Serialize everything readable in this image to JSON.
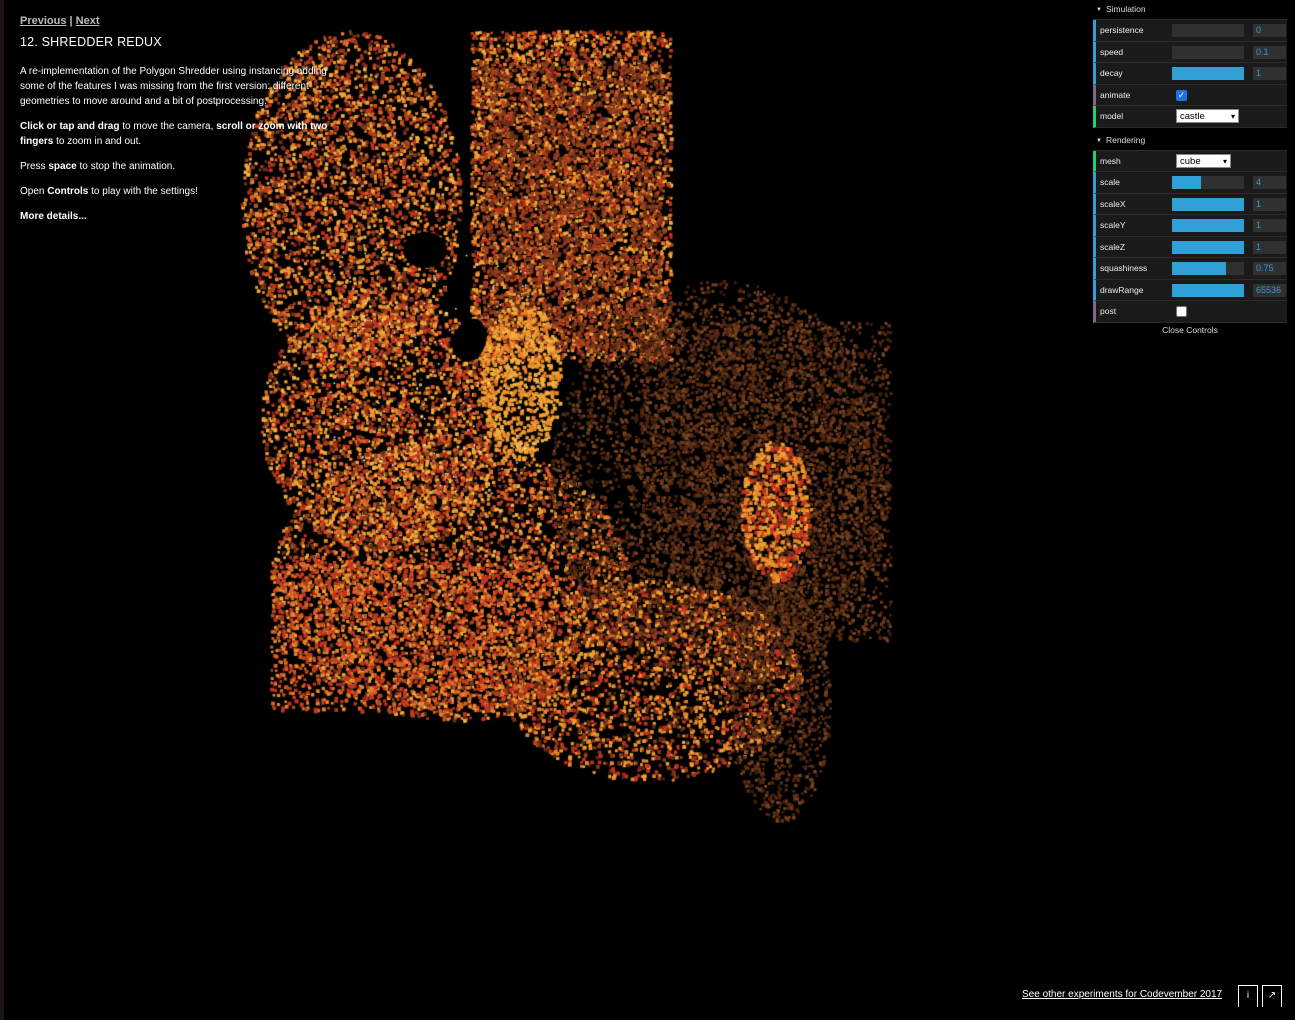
{
  "nav": {
    "previous": "Previous",
    "separator": "|",
    "next": "Next"
  },
  "title": "12. SHREDDER REDUX",
  "description": "A re-implementation of the Polygon Shredder using instancing adding some of the features I was missing from the first version: different geometries to move around and a bit of postprocessing.",
  "controls_help": {
    "click_drag": "Click or tap and drag",
    "move_camera": " to move the camera, ",
    "scroll_zoom": "scroll or zoom with two fingers",
    "zoom_inout": " to zoom in and out."
  },
  "space_help": {
    "press": "Press ",
    "key": "space",
    "rest": " to stop the animation."
  },
  "open_controls": {
    "pre": "Open ",
    "bold": "Controls",
    "post": " to play with the settings!"
  },
  "more_details": "More details...",
  "gui": {
    "simulation_title": "Simulation",
    "simulation": {
      "persistence": {
        "label": "persistence",
        "value": "0",
        "fill": 0.0
      },
      "speed": {
        "label": "speed",
        "value": "0.1",
        "fill": 0.0
      },
      "decay": {
        "label": "decay",
        "value": "1",
        "fill": 1.0
      },
      "animate": {
        "label": "animate",
        "checked": true
      },
      "model": {
        "label": "model",
        "value": "castle"
      }
    },
    "rendering_title": "Rendering",
    "rendering": {
      "mesh": {
        "label": "mesh",
        "value": "cube"
      },
      "scale": {
        "label": "scale",
        "value": "4",
        "fill": 0.4
      },
      "scaleX": {
        "label": "scaleX",
        "value": "1",
        "fill": 1.0
      },
      "scaleY": {
        "label": "scaleY",
        "value": "1",
        "fill": 1.0
      },
      "scaleZ": {
        "label": "scaleZ",
        "value": "1",
        "fill": 1.0
      },
      "squashiness": {
        "label": "squashiness",
        "value": "0.75",
        "fill": 0.75
      },
      "drawRange": {
        "label": "drawRange",
        "value": "65536",
        "fill": 1.0
      },
      "post": {
        "label": "post",
        "checked": false
      }
    },
    "close_controls": "Close Controls"
  },
  "footer": {
    "link": "See other experiments for Codevember 2017",
    "info_button": "i",
    "external_button": "↗"
  },
  "colors": {
    "accent": "#2fa1d6",
    "point_a": "#e8862a",
    "point_b": "#c8321e"
  }
}
